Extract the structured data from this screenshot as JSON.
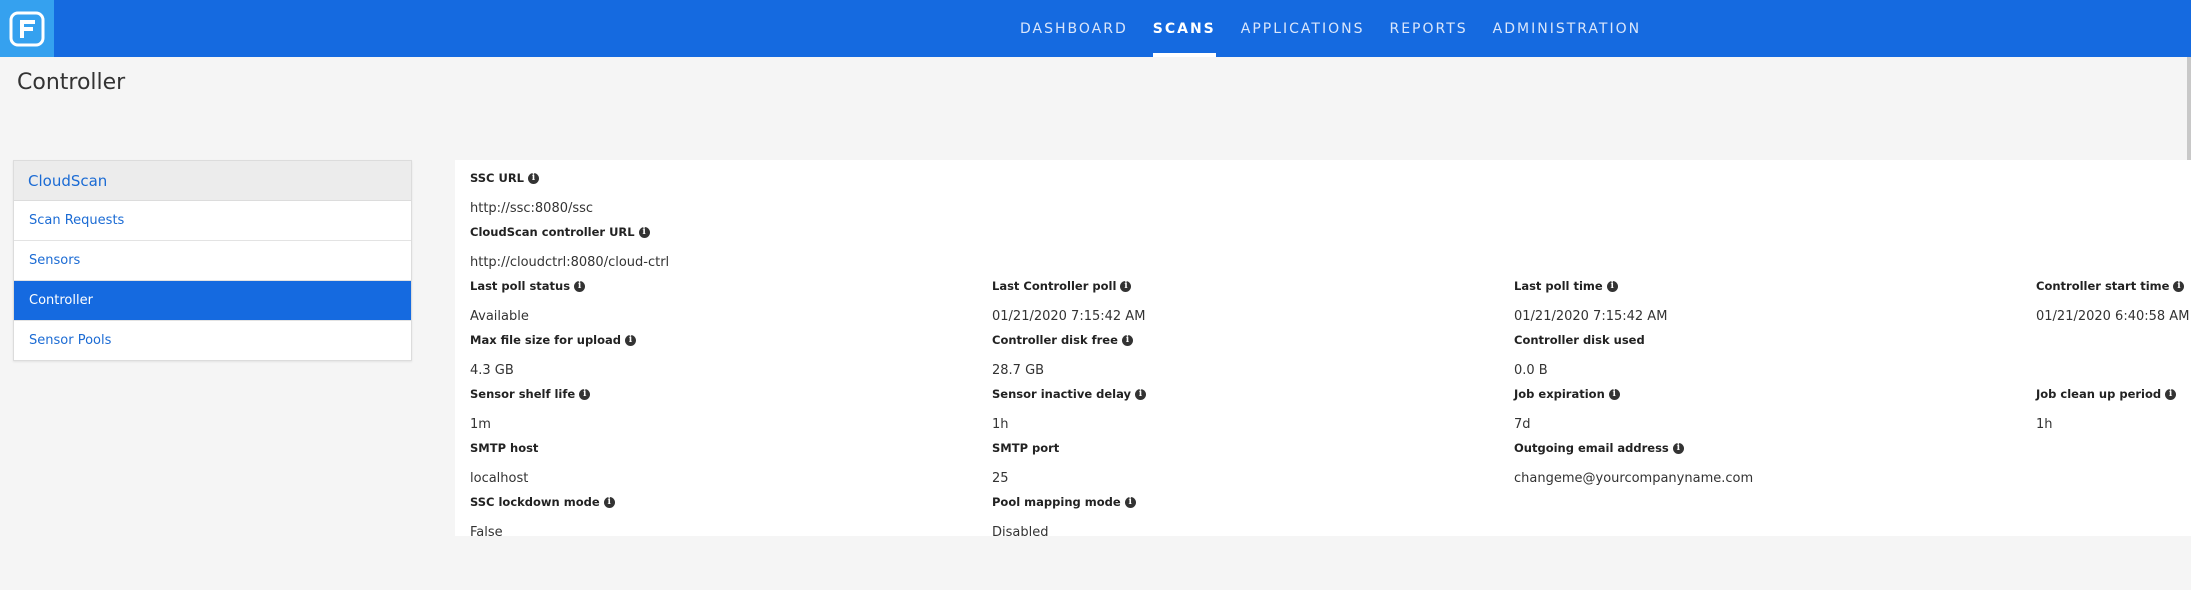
{
  "nav": {
    "items": [
      {
        "label": "DASHBOARD"
      },
      {
        "label": "SCANS",
        "active": true
      },
      {
        "label": "APPLICATIONS"
      },
      {
        "label": "REPORTS"
      },
      {
        "label": "ADMINISTRATION"
      }
    ]
  },
  "page": {
    "title": "Controller"
  },
  "sidebar": {
    "header": "CloudScan",
    "items": [
      {
        "label": "Scan Requests"
      },
      {
        "label": "Sensors"
      },
      {
        "label": "Controller",
        "active": true
      },
      {
        "label": "Sensor Pools"
      }
    ]
  },
  "fields": [
    {
      "label": "SSC URL",
      "value": "http://ssc:8080/ssc",
      "info": true
    },
    {
      "label": "CloudScan controller URL",
      "value": "http://cloudctrl:8080/cloud-ctrl",
      "info": true
    },
    {
      "label": "Last poll status",
      "value": "Available",
      "info": true
    },
    {
      "label": "Last Controller poll",
      "value": "01/21/2020 7:15:42 AM",
      "info": true
    },
    {
      "label": "Last poll time",
      "value": "01/21/2020 7:15:42 AM",
      "info": true
    },
    {
      "label": "Controller start time",
      "value": "01/21/2020 6:40:58 AM",
      "info": true
    },
    {
      "label": "Max file size for upload",
      "value": "4.3 GB",
      "info": true
    },
    {
      "label": "Controller disk free",
      "value": "28.7 GB",
      "info": true
    },
    {
      "label": "Controller disk used",
      "value": "0.0 B",
      "info": false
    },
    {
      "label": "Sensor shelf life",
      "value": "1m",
      "info": true
    },
    {
      "label": "Sensor inactive delay",
      "value": "1h",
      "info": true
    },
    {
      "label": "Job expiration",
      "value": "7d",
      "info": true
    },
    {
      "label": "Job clean up period",
      "value": "1h",
      "info": true
    },
    {
      "label": "SMTP host",
      "value": "localhost",
      "info": false
    },
    {
      "label": "SMTP port",
      "value": "25",
      "info": false
    },
    {
      "label": "Outgoing email address",
      "value": "changeme@yourcompanyname.com",
      "info": true
    },
    {
      "label": "SSC lockdown mode",
      "value": "False",
      "info": true
    },
    {
      "label": "Pool mapping mode",
      "value": "Disabled",
      "info": true
    }
  ],
  "colors": {
    "brand": "#156ae0",
    "logo_bg": "#35a1ef",
    "link": "#1b6bd4"
  },
  "icons": {
    "info": "info-icon",
    "logo": "logo-icon"
  }
}
